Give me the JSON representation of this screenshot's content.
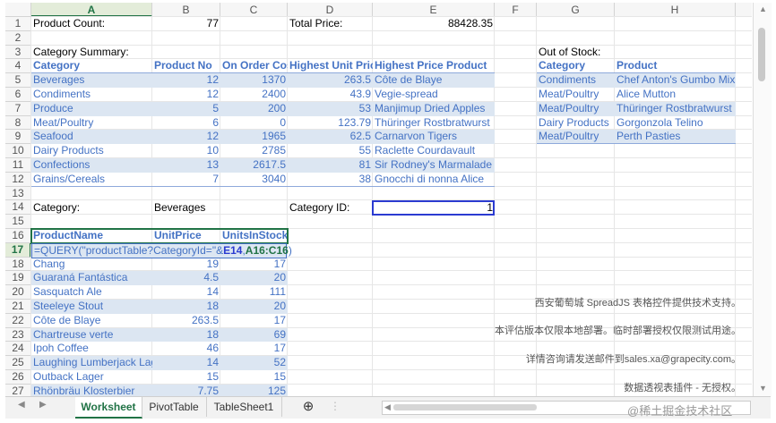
{
  "columns": [
    "A",
    "B",
    "C",
    "D",
    "E",
    "F",
    "G",
    "H"
  ],
  "rows": [
    "1",
    "2",
    "3",
    "4",
    "5",
    "6",
    "7",
    "8",
    "9",
    "10",
    "11",
    "12",
    "13",
    "14",
    "15",
    "16",
    "17",
    "18",
    "19",
    "20",
    "21",
    "22",
    "23",
    "24",
    "25",
    "26",
    "27"
  ],
  "top": {
    "product_count_label": "Product Count:",
    "product_count_value": "77",
    "total_price_label": "Total Price:",
    "total_price_value": "88428.35",
    "category_summary_label": "Category Summary:",
    "out_of_stock_label": "Out of Stock:"
  },
  "summary": {
    "headers": [
      "Category",
      "Product No",
      "On Order Cost",
      "Highest Unit Price",
      "Highest Price Product"
    ],
    "rows": [
      [
        "Beverages",
        "12",
        "1370",
        "263.5",
        "Côte de Blaye"
      ],
      [
        "Condiments",
        "12",
        "2400",
        "43.9",
        "Vegie-spread"
      ],
      [
        "Produce",
        "5",
        "200",
        "53",
        "Manjimup Dried Apples"
      ],
      [
        "Meat/Poultry",
        "6",
        "0",
        "123.79",
        "Thüringer Rostbratwurst"
      ],
      [
        "Seafood",
        "12",
        "1965",
        "62.5",
        "Carnarvon Tigers"
      ],
      [
        "Dairy Products",
        "10",
        "2785",
        "55",
        "Raclette Courdavault"
      ],
      [
        "Confections",
        "13",
        "2617.5",
        "81",
        "Sir Rodney's Marmalade"
      ],
      [
        "Grains/Cereals",
        "7",
        "3040",
        "38",
        "Gnocchi di nonna Alice"
      ]
    ]
  },
  "out_of_stock": {
    "headers": [
      "Category",
      "Product"
    ],
    "rows": [
      [
        "Condiments",
        "Chef Anton's Gumbo Mix"
      ],
      [
        "Meat/Poultry",
        "Alice Mutton"
      ],
      [
        "Meat/Poultry",
        "Thüringer Rostbratwurst"
      ],
      [
        "Dairy Products",
        "Gorgonzola Telino"
      ],
      [
        "Meat/Poultry",
        "Perth Pasties"
      ]
    ]
  },
  "filter": {
    "category_label": "Category:",
    "category_value": "Beverages",
    "category_id_label": "Category ID:",
    "category_id_value": "1"
  },
  "products": {
    "headers": [
      "ProductName",
      "UnitPrice",
      "UnitsInStock"
    ],
    "formula_parts": [
      "=QUERY(\"productTable?CategoryId=\"&",
      "E14",
      ",",
      "A16:C16",
      ")"
    ],
    "rows": [
      [
        "Chang",
        "19",
        "17"
      ],
      [
        "Guaraná Fantástica",
        "4.5",
        "20"
      ],
      [
        "Sasquatch Ale",
        "14",
        "111"
      ],
      [
        "Steeleye Stout",
        "18",
        "20"
      ],
      [
        "Côte de Blaye",
        "263.5",
        "17"
      ],
      [
        "Chartreuse verte",
        "18",
        "69"
      ],
      [
        "Ipoh Coffee",
        "46",
        "17"
      ],
      [
        "Laughing Lumberjack Lager",
        "14",
        "52"
      ],
      [
        "Outback Lager",
        "15",
        "15"
      ],
      [
        "Rhönbräu Klosterbier",
        "7.75",
        "125"
      ]
    ]
  },
  "watermark": [
    "西安葡萄城 SpreadJS 表格控件提供技术支持。",
    "本评估版本仅限本地部署。临时部署授权仅限测试用途。",
    "详情咨询请发送邮件到sales.xa@grapecity.com。",
    "数据透视表插件 - 无授权。"
  ],
  "tabs": [
    "Worksheet",
    "PivotTable",
    "TableSheet1"
  ],
  "add_sheet_symbol": "⊕",
  "footer_text": "@稀土掘金技术社区",
  "colors": {
    "accent": "#217346",
    "table_text": "#4472c4",
    "band": "#dce6f2",
    "selection": "#2b3bd1"
  }
}
